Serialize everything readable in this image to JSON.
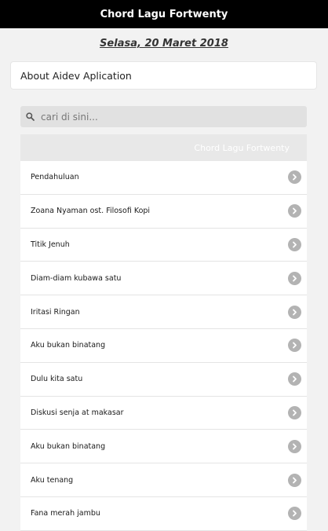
{
  "header": {
    "title": "Chord Lagu Fortwenty"
  },
  "date": "Selasa, 20 Maret 2018",
  "about": {
    "label": "About Aidev Aplication"
  },
  "search": {
    "placeholder": "cari di sini...",
    "icon": "search-icon"
  },
  "list": {
    "header": "Chord Lagu Fortwenty",
    "items": [
      "Pendahuluan",
      "Zoana Nyaman ost. Filosofi Kopi",
      "Titik Jenuh",
      "Diam-diam kubawa satu",
      "Iritasi Ringan",
      "Aku bukan binatang",
      "Dulu kita satu",
      "Diskusi senja at makasar",
      "Aku bukan binatang",
      "Aku tenang",
      "Fana merah jambu"
    ],
    "item_icon": "chevron-right-icon"
  },
  "colors": {
    "topbar": "#000000",
    "chevron": "#b3b3b3",
    "background": "#f2f2f2"
  }
}
